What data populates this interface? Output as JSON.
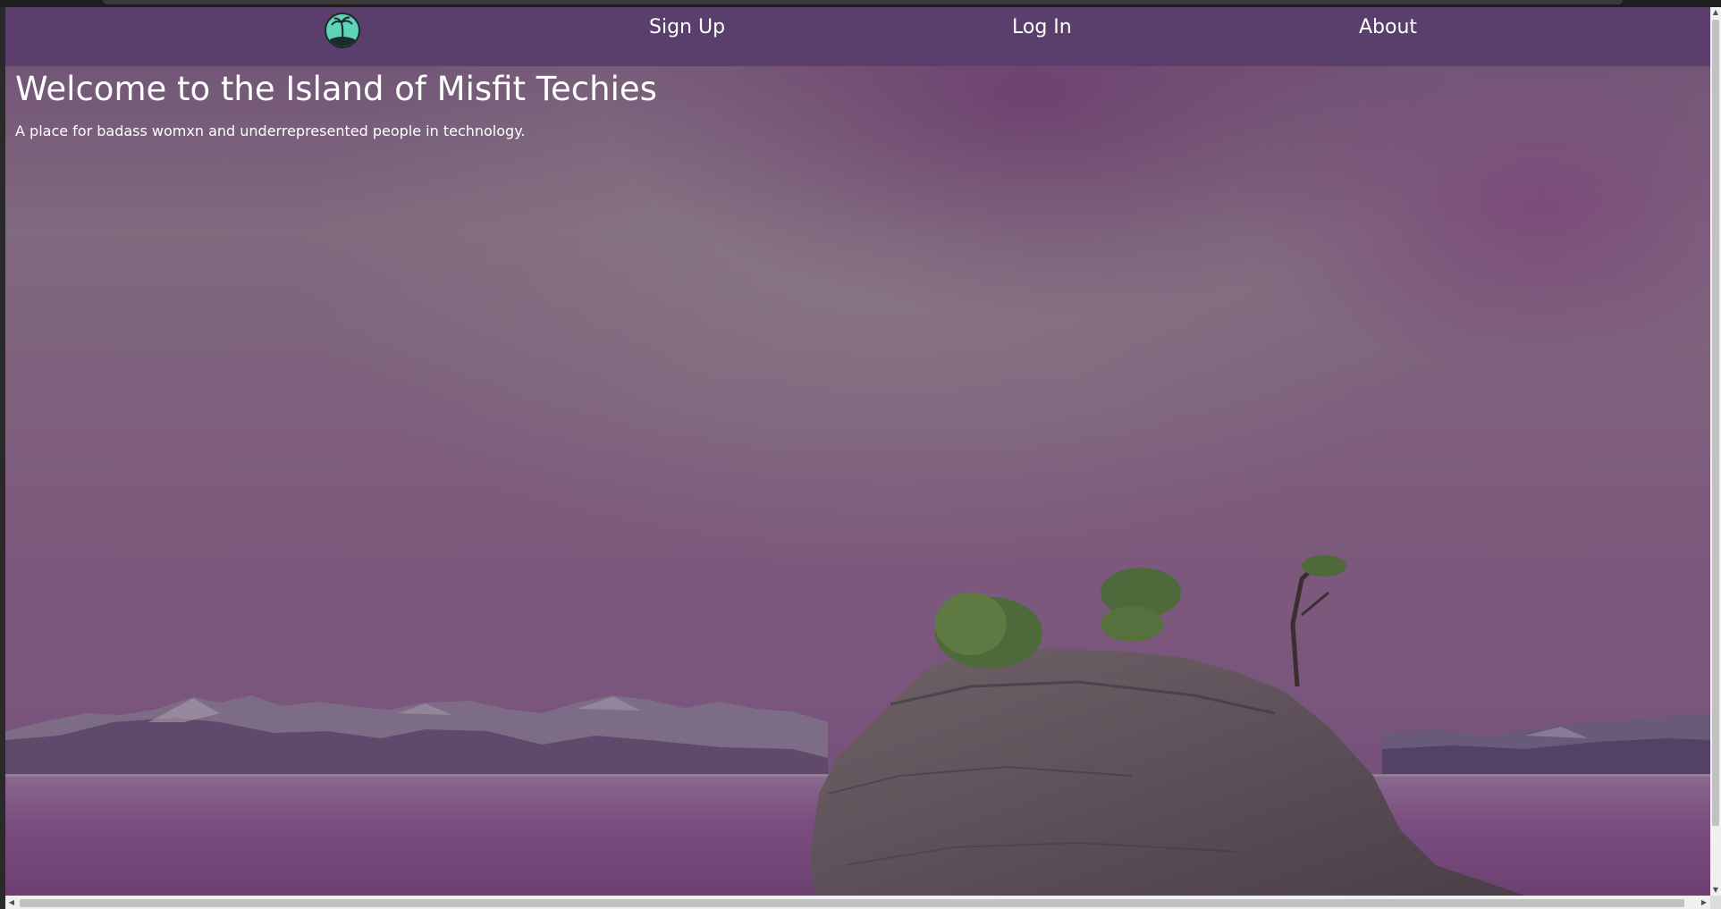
{
  "nav": {
    "logo_icon": "palm-tree-island-icon",
    "signup_label": "Sign Up",
    "login_label": "Log In",
    "about_label": "About"
  },
  "hero": {
    "title": "Welcome to the Island of Misfit Techies",
    "subtitle": "A place for badass womxn and underrepresented people in technology."
  },
  "colors": {
    "navbar": "#5a3f6c",
    "overlay": "#7a5a78",
    "logo_bg": "#5fd3b8",
    "text": "#ffffff"
  },
  "scrollbars": {
    "up_arrow": "▲",
    "down_arrow": "▼",
    "left_arrow": "◀",
    "right_arrow": "▶"
  }
}
